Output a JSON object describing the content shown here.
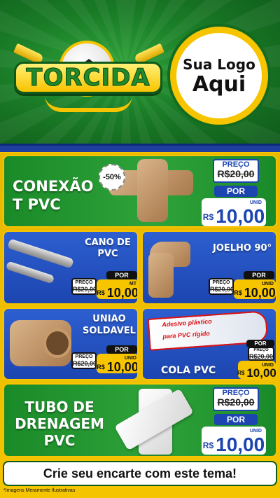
{
  "header": {
    "title": "TORCIDA",
    "logo_line1": "Sua Logo",
    "logo_line2": "Aqui"
  },
  "products": {
    "conexao": {
      "title_line1": "CONEXÃO",
      "title_line2": "T PVC",
      "discount": "-50%",
      "preco_label": "PREÇO",
      "old_price": "R$20,00",
      "por_label": "POR",
      "currency": "R$",
      "price": "10,00",
      "unit": "UNID"
    },
    "cano": {
      "title_line1": "CANO DE",
      "title_line2": "PVC",
      "preco_label": "PREÇO",
      "old_price": "R$20,00",
      "por_label": "POR",
      "currency": "R$",
      "price": "10,00",
      "unit": "MT"
    },
    "joelho": {
      "title": "JOELHO 90°",
      "preco_label": "PREÇO",
      "old_price": "R$20,00",
      "por_label": "POR",
      "currency": "R$",
      "price": "10,00",
      "unit": "UNID"
    },
    "uniao": {
      "title_line1": "UNIAO",
      "title_line2": "SOLDAVEL",
      "preco_label": "PREÇO",
      "old_price": "R$20,00",
      "por_label": "POR",
      "currency": "R$",
      "price": "10,00",
      "unit": "UNID"
    },
    "cola": {
      "title": "COLA PVC",
      "tube_text_line1": "Adesivo plástico",
      "tube_text_line2": "para PVC rígido",
      "preco_label": "PREÇO",
      "old_price": "R$20,00",
      "por_label": "POR",
      "currency": "R$",
      "price": "10,00",
      "unit": "UNID"
    },
    "tubo": {
      "title_line1": "TUBO DE",
      "title_line2": "DRENAGEM",
      "title_line3": "PVC",
      "preco_label": "PREÇO",
      "old_price": "R$20,00",
      "por_label": "POR",
      "currency": "R$",
      "price": "10,00",
      "unit": "UNID"
    }
  },
  "footer": {
    "cta": "Crie seu encarte com este tema!",
    "disclaimer": "*Imagens Meramente Ilustrativas"
  },
  "colors": {
    "green": "#1a8a28",
    "blue": "#1c45b0",
    "yellow": "#f7c400"
  }
}
